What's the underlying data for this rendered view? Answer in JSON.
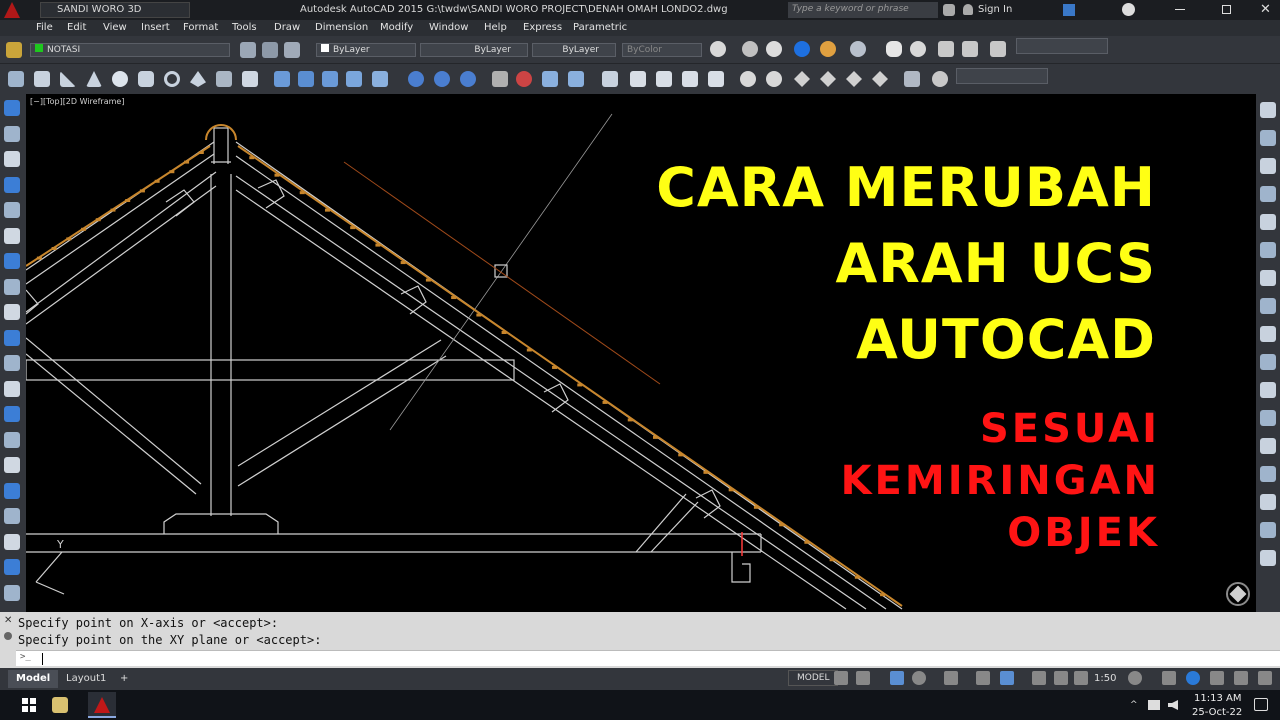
{
  "titlebar": {
    "workspace": "SANDI WORO 3D",
    "title": "Autodesk AutoCAD 2015    G:\\twdw\\SANDI WORO PROJECT\\DENAH OMAH LONDO2.dwg",
    "search_placeholder": "Type a keyword or phrase",
    "sign_in": "Sign In"
  },
  "menu": [
    "File",
    "Edit",
    "View",
    "Insert",
    "Format",
    "Tools",
    "Draw",
    "Dimension",
    "Modify",
    "Window",
    "Help",
    "Express",
    "Parametric"
  ],
  "properties": {
    "layer": "NOTASI",
    "color": "ByLayer",
    "linetype": "ByLayer",
    "lineweight": "ByLayer",
    "plotstyle": "ByColor"
  },
  "viewport": {
    "label": "[−][Top][2D Wireframe]",
    "ucs_y": "Y"
  },
  "overlay": {
    "line1": "CARA MERUBAH",
    "line2": "ARAH UCS",
    "line3": "AUTOCAD",
    "line4": "SESUAI",
    "line5": "KEMIRINGAN",
    "line6": "OBJEK"
  },
  "command": {
    "history1": "Specify point on X-axis or <accept>:",
    "history2": "Specify point on the XY plane or <accept>:",
    "prompt_icon": ">_"
  },
  "layout_tabs": [
    "Model",
    "Layout1"
  ],
  "status": {
    "model": "MODEL",
    "scale": "1:50"
  },
  "taskbar": {
    "time": "11:13 AM",
    "date": "25-Oct-22"
  },
  "colors": {
    "title_yellow": "#ffff14",
    "title_red": "#ff1414",
    "roof_tile": "#c8862c",
    "wire": "#d0d0d0"
  }
}
